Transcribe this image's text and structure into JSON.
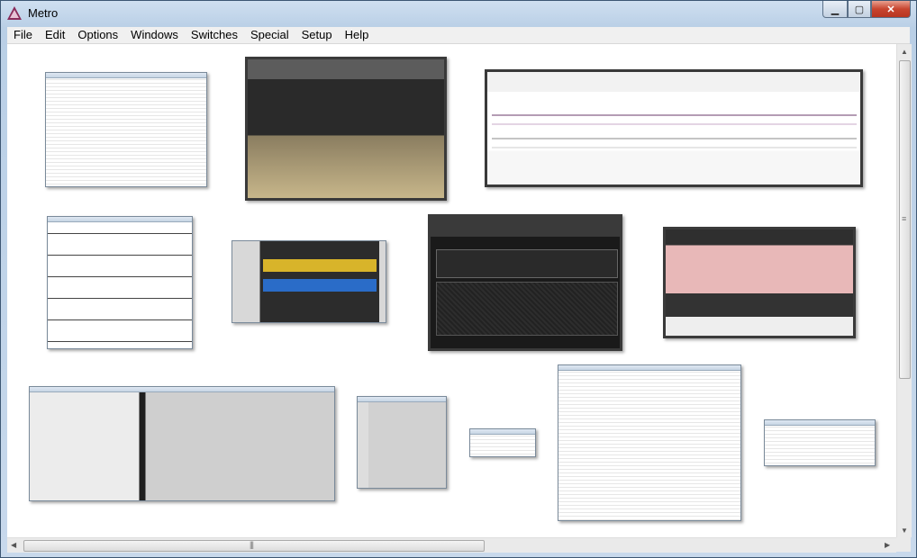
{
  "window": {
    "title": "Metro",
    "app_icon": "metro-logo-icon"
  },
  "controls": {
    "minimize": "minimize-icon",
    "maximize": "maximize-icon",
    "close": "close-icon"
  },
  "menu": [
    "File",
    "Edit",
    "Options",
    "Windows",
    "Switches",
    "Special",
    "Setup",
    "Help"
  ],
  "thumbnails": [
    {
      "name": "plugin-manager-window-thumbnail",
      "style": "list"
    },
    {
      "name": "drum-sampler-window-thumbnail",
      "style": "instrument"
    },
    {
      "name": "piano-roll-window-thumbnail",
      "style": "pianoroll"
    },
    {
      "name": "notation-window-thumbnail",
      "style": "score"
    },
    {
      "name": "effect-plugin-window-thumbnail",
      "style": "effect"
    },
    {
      "name": "amp-simulator-window-thumbnail",
      "style": "amp"
    },
    {
      "name": "synth-keyboard-window-thumbnail",
      "style": "synth"
    },
    {
      "name": "track-overview-window-thumbnail",
      "style": "tracks"
    },
    {
      "name": "mixer-window-thumbnail",
      "style": "mixer"
    },
    {
      "name": "small-dialog-window-thumbnail",
      "style": "dialog"
    },
    {
      "name": "file-browser-window-thumbnail",
      "style": "browser"
    },
    {
      "name": "small-list-window-thumbnail",
      "style": "list"
    }
  ]
}
